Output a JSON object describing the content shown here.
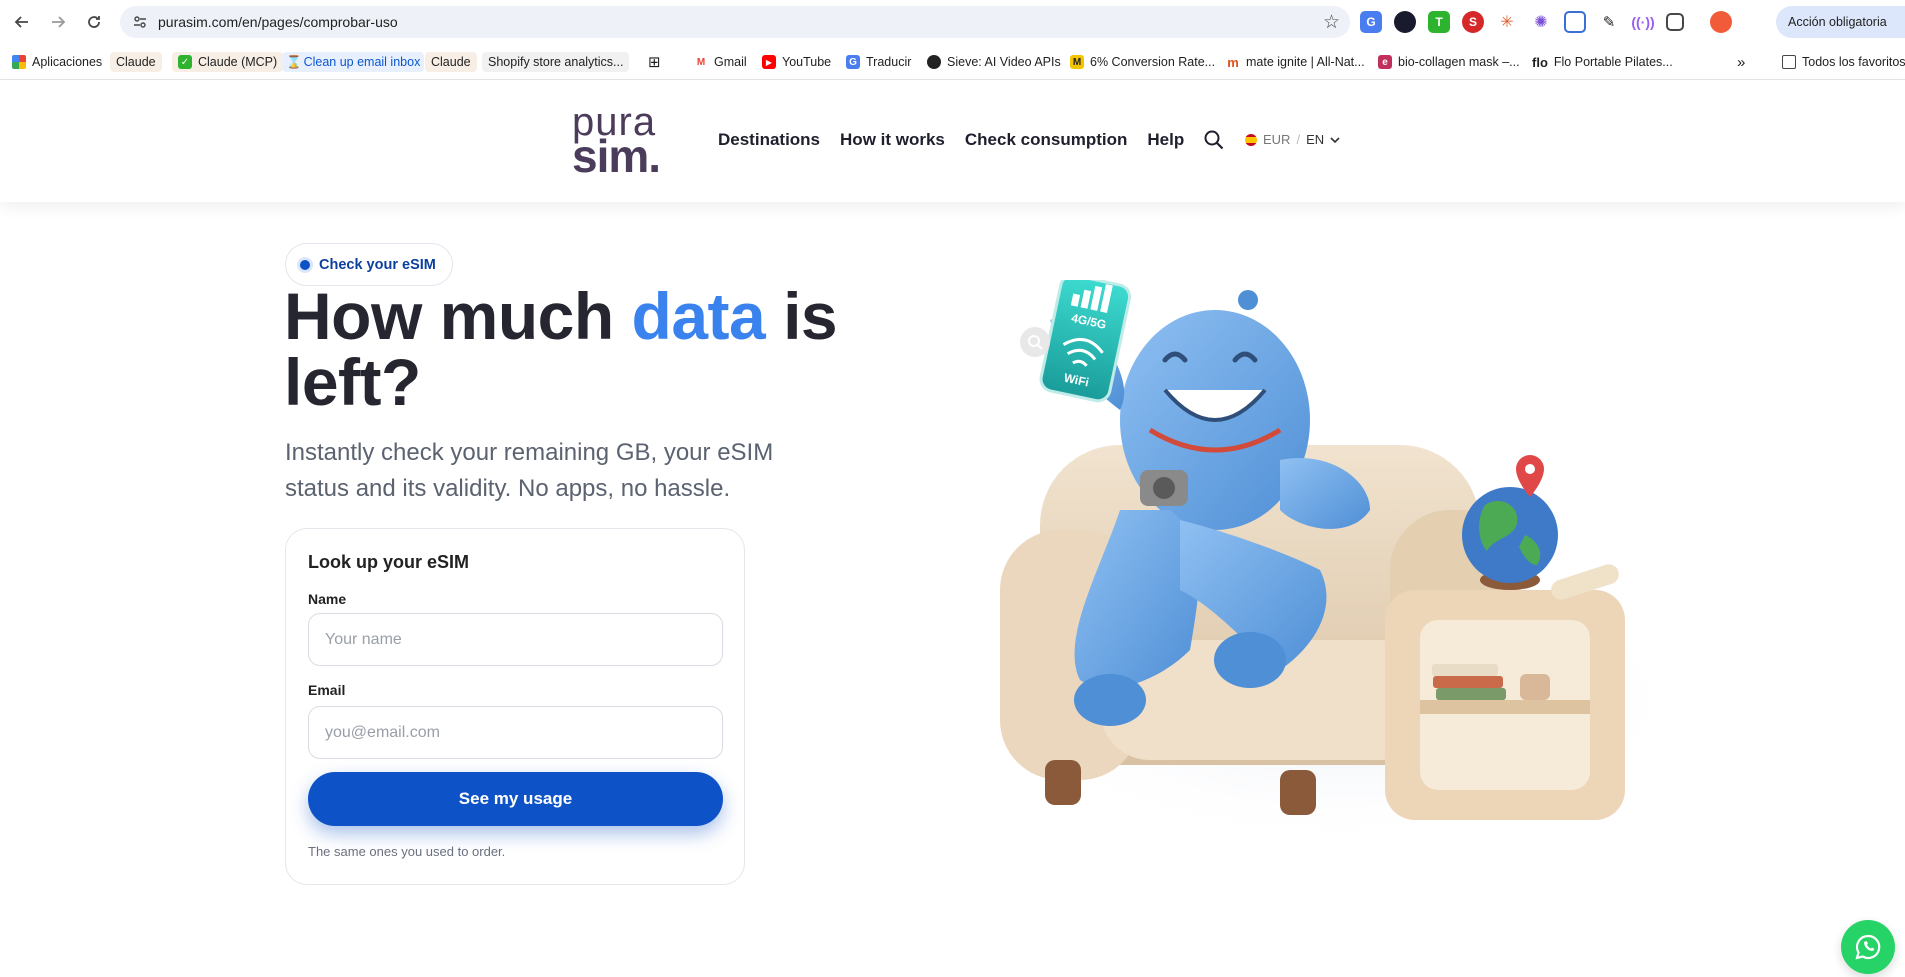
{
  "browser": {
    "url": "purasim.com/en/pages/comprobar-uso",
    "profile_button": "Acción obligatoria",
    "bookmarks": [
      {
        "label": "Aplicaciones"
      },
      {
        "label": "Claude"
      },
      {
        "label": "Claude (MCP)"
      },
      {
        "label": "Clean up email inbox"
      },
      {
        "label": "Claude"
      },
      {
        "label": "Shopify store analytics..."
      },
      {
        "label": "Gmail"
      },
      {
        "label": "YouTube"
      },
      {
        "label": "Traducir"
      },
      {
        "label": "Sieve: AI Video APIs"
      },
      {
        "label": "6% Conversion Rate..."
      },
      {
        "label": "mate ignite | All-Nat..."
      },
      {
        "label": "bio-collagen mask –..."
      },
      {
        "label": "Flo Portable Pilates..."
      }
    ],
    "all_bookmarks": "Todos los favoritos",
    "overflow": "»"
  },
  "header": {
    "logo_top": "pura",
    "logo_bottom": "sim.",
    "nav": [
      "Destinations",
      "How it works",
      "Check consumption",
      "Help"
    ],
    "currency": "EUR",
    "separator": "/",
    "language": "EN"
  },
  "hero": {
    "badge": "Check your eSIM",
    "title_before": "How much ",
    "title_accent": "data",
    "title_after": " is left?",
    "subtitle": "Instantly check your remaining GB, your eSIM status and its validity. No apps, no hassle."
  },
  "form": {
    "heading": "Look up your eSIM",
    "name_label": "Name",
    "name_placeholder": "Your name",
    "email_label": "Email",
    "email_placeholder": "you@email.com",
    "submit": "See my usage",
    "hint": "The same ones you used to order."
  },
  "illustration": {
    "phone_text_top": "4G/5G",
    "phone_text_bottom": "WiFi"
  },
  "colors": {
    "accent": "#3a82ee",
    "primary_button": "#0d52c7",
    "logo": "#4a3c5a",
    "whatsapp": "#25d366"
  }
}
